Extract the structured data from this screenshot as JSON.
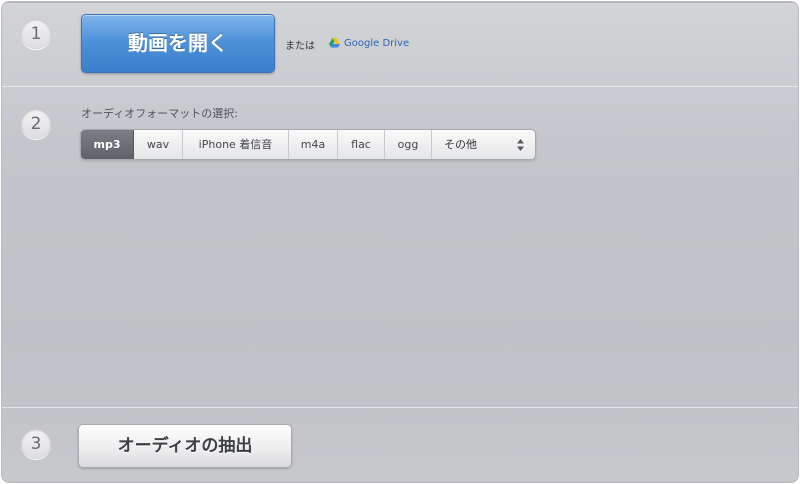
{
  "steps": {
    "one": "1",
    "two": "2",
    "three": "3"
  },
  "open_section": {
    "open_button_label": "動画を開く",
    "or_text": "または",
    "google_drive_label": "Google Drive"
  },
  "format_section": {
    "label": "オーディオフォーマットの選択:",
    "formats": [
      "mp3",
      "wav",
      "iPhone 着信音",
      "m4a",
      "flac",
      "ogg"
    ],
    "selected": "mp3",
    "other_label": "その他"
  },
  "extract_section": {
    "button_label": "オーディオの抽出"
  },
  "colors": {
    "primary_button": "#4e92d9",
    "selected_format": "#666972",
    "link": "#2a66b6"
  },
  "icons": {
    "google_drive": "google-drive-icon",
    "select_arrows": "up-down-arrows-icon"
  }
}
